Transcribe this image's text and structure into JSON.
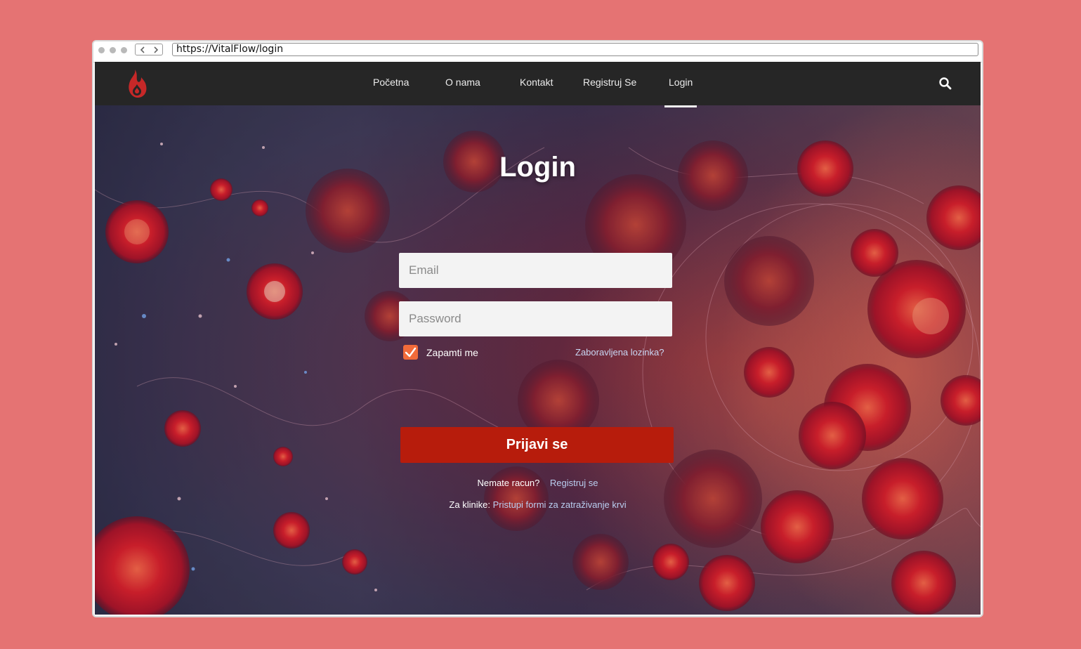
{
  "browser": {
    "url": "https://VitalFlow/login"
  },
  "nav": {
    "items": [
      {
        "label": "Početna"
      },
      {
        "label": "O nama"
      },
      {
        "label": "Kontakt"
      },
      {
        "label": "Registruj Se"
      },
      {
        "label": "Login"
      }
    ],
    "active": "Login"
  },
  "login": {
    "title": "Login",
    "email_placeholder": "Email",
    "password_placeholder": "Password",
    "remember_label": "Zapamti me",
    "remember_checked": true,
    "forgot_label": "Zaboravljena lozinka?",
    "submit_label": "Prijavi se",
    "no_account_text": "Nemate racun?",
    "register_link": "Registruj se",
    "clinics_text": "Za klinike:",
    "clinics_link": "Pristupi formi za zatraživanje krvi"
  },
  "colors": {
    "page_background": "#e57373",
    "navbar": "#262626",
    "brand_red": "#c62828",
    "submit_button": "#b71c0c",
    "checkbox": "#f26b3a",
    "link": "#b9cef0"
  },
  "icons": {
    "logo": "blood-drop-flame-icon",
    "search": "search-icon",
    "checkbox": "checkmark-icon"
  }
}
